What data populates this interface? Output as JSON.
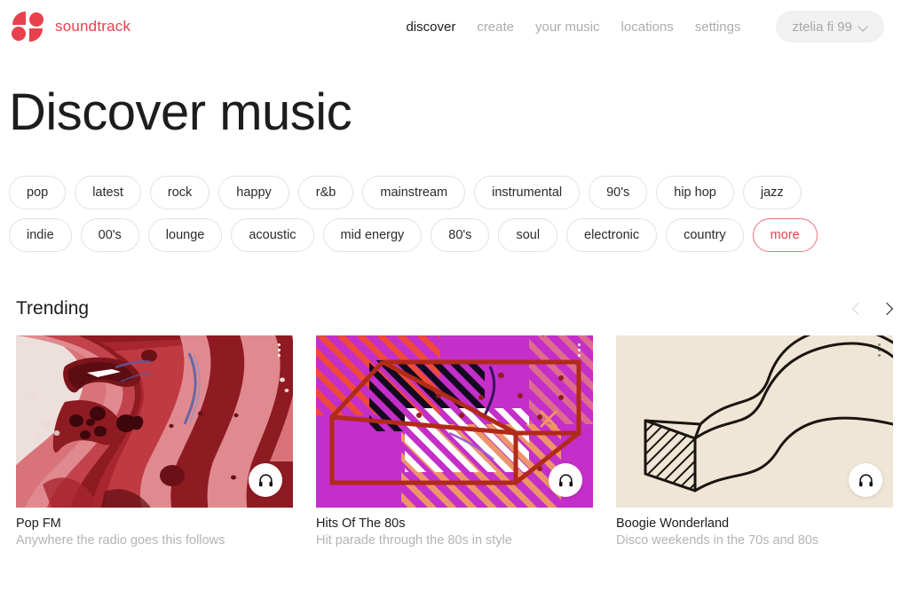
{
  "brand": {
    "name": "soundtrack",
    "logo_icon": "soundtrack-logo",
    "accent": "#e8414d"
  },
  "nav": {
    "items": [
      {
        "label": "discover",
        "active": true
      },
      {
        "label": "create",
        "active": false
      },
      {
        "label": "your music",
        "active": false
      },
      {
        "label": "locations",
        "active": false
      },
      {
        "label": "settings",
        "active": false
      }
    ],
    "user": {
      "name": "ztelia fi 99",
      "chevron_icon": "chevron-down-icon"
    }
  },
  "page": {
    "title": "Discover music"
  },
  "chips": [
    {
      "label": "pop",
      "accent": false
    },
    {
      "label": "latest",
      "accent": false
    },
    {
      "label": "rock",
      "accent": false
    },
    {
      "label": "happy",
      "accent": false
    },
    {
      "label": "r&b",
      "accent": false
    },
    {
      "label": "mainstream",
      "accent": false
    },
    {
      "label": "instrumental",
      "accent": false
    },
    {
      "label": "90's",
      "accent": false
    },
    {
      "label": "hip hop",
      "accent": false
    },
    {
      "label": "jazz",
      "accent": false
    },
    {
      "label": "indie",
      "accent": false
    },
    {
      "label": "00's",
      "accent": false
    },
    {
      "label": "lounge",
      "accent": false
    },
    {
      "label": "acoustic",
      "accent": false
    },
    {
      "label": "mid energy",
      "accent": false
    },
    {
      "label": "80's",
      "accent": false
    },
    {
      "label": "soul",
      "accent": false
    },
    {
      "label": "electronic",
      "accent": false
    },
    {
      "label": "country",
      "accent": false
    },
    {
      "label": "more",
      "accent": true
    }
  ],
  "trending": {
    "title": "Trending",
    "prev_icon": "chevron-left-icon",
    "next_icon": "chevron-right-icon",
    "cards": [
      {
        "title": "Pop FM",
        "subtitle": "Anywhere the radio goes this follows",
        "artwork": "red-marbled-liquid-abstract",
        "menu_icon": "more-vertical-icon",
        "play_icon": "headphones-icon"
      },
      {
        "title": "Hits Of The 80s",
        "subtitle": "Hit parade through the 80s in style",
        "artwork": "magenta-3d-box-stripes",
        "menu_icon": "more-vertical-icon",
        "play_icon": "headphones-icon"
      },
      {
        "title": "Boogie Wonderland",
        "subtitle": "Disco weekends in the 70s and 80s",
        "artwork": "cream-wavy-beam-linedrawing",
        "menu_icon": "more-vertical-icon",
        "play_icon": "headphones-icon"
      }
    ]
  }
}
